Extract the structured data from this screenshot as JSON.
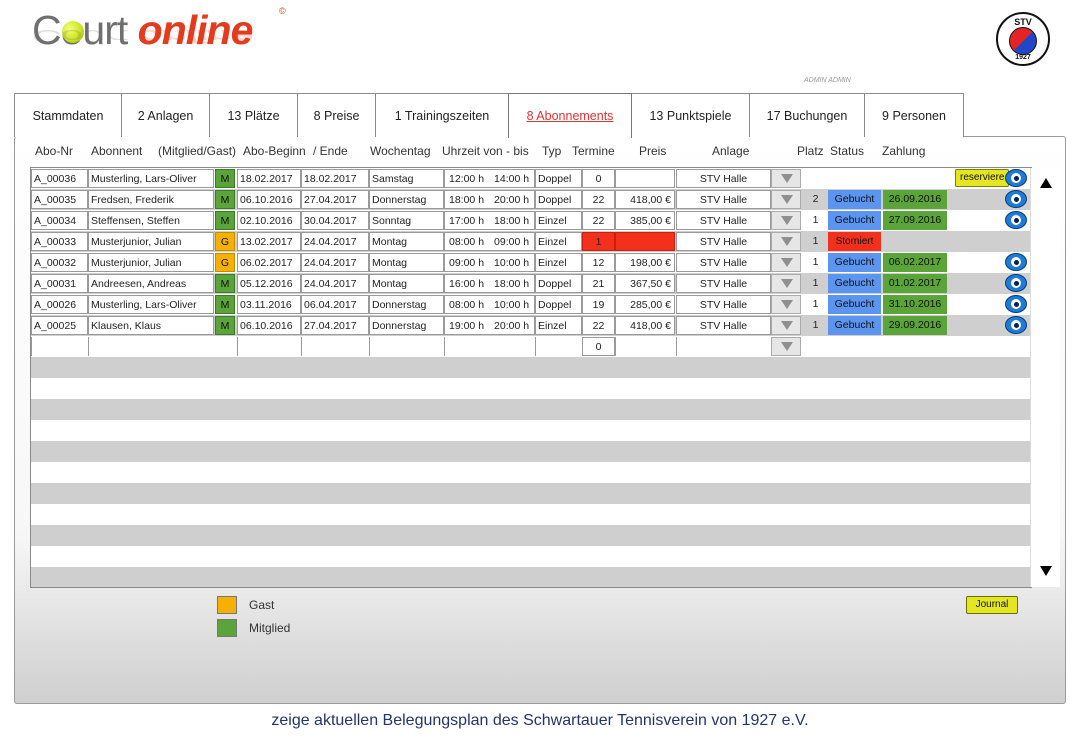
{
  "header": {
    "logo_court": "Court",
    "logo_online": "online",
    "logo_copyright": "©",
    "seal_top": "STV",
    "seal_bottom": "1927",
    "user_label": "ADMIN ADMIN"
  },
  "tabs": [
    {
      "label": "Stammdaten",
      "active": false
    },
    {
      "label": "2 Anlagen",
      "active": false
    },
    {
      "label": "13 Plätze",
      "active": false
    },
    {
      "label": "8 Preise",
      "active": false
    },
    {
      "label": "1 Trainingszeiten",
      "active": false
    },
    {
      "label": "8 Abonnements",
      "active": true
    },
    {
      "label": "13 Punktspiele",
      "active": false
    },
    {
      "label": "17 Buchungen",
      "active": false
    },
    {
      "label": "9 Personen",
      "active": false
    }
  ],
  "columns": {
    "abo_nr": "Abo-Nr",
    "abonnent": "Abonnent",
    "mitglied_gast": "(Mitglied/Gast)",
    "abo_beginn": "Abo-Beginn",
    "ende": "/ Ende",
    "wochentag": "Wochentag",
    "uhrzeit": "Uhrzeit von - bis",
    "typ": "Typ",
    "termine": "Termine",
    "preis": "Preis",
    "anlage": "Anlage",
    "platz": "Platz",
    "status": "Status",
    "zahlung": "Zahlung"
  },
  "rows": [
    {
      "abo_nr": "A_00036",
      "abonnent": "Musterling, Lars-Oliver",
      "mg": "M",
      "beginn": "18.02.2017",
      "ende": "18.02.2017",
      "wochentag": "Samstag",
      "von": "12:00 h",
      "bis": "14:00 h",
      "typ": "Doppel",
      "termine": "0",
      "preis": "",
      "anlage": "STV Halle",
      "platz": "",
      "status": "",
      "zahlung": "",
      "action": "reserviere",
      "eye": true
    },
    {
      "abo_nr": "A_00035",
      "abonnent": "Fredsen, Frederik",
      "mg": "M",
      "beginn": "06.10.2016",
      "ende": "27.04.2017",
      "wochentag": "Donnerstag",
      "von": "18:00 h",
      "bis": "20:00 h",
      "typ": "Doppel",
      "termine": "22",
      "preis": "418,00 €",
      "anlage": "STV Halle",
      "platz": "2",
      "status": "Gebucht",
      "zahlung": "26.09.2016",
      "action": "",
      "eye": true
    },
    {
      "abo_nr": "A_00034",
      "abonnent": "Steffensen, Steffen",
      "mg": "M",
      "beginn": "02.10.2016",
      "ende": "30.04.2017",
      "wochentag": "Sonntag",
      "von": "17:00 h",
      "bis": "18:00 h",
      "typ": "Einzel",
      "termine": "22",
      "preis": "385,00 €",
      "anlage": "STV Halle",
      "platz": "1",
      "status": "Gebucht",
      "zahlung": "27.09.2016",
      "action": "",
      "eye": true
    },
    {
      "abo_nr": "A_00033",
      "abonnent": "Musterjunior, Julian",
      "mg": "G",
      "beginn": "13.02.2017",
      "ende": "24.04.2017",
      "wochentag": "Montag",
      "von": "08:00 h",
      "bis": "09:00 h",
      "typ": "Einzel",
      "termine": "1",
      "preis": "",
      "anlage": "STV Halle",
      "platz": "1",
      "status": "Storniert",
      "zahlung": "",
      "action": "",
      "eye": false
    },
    {
      "abo_nr": "A_00032",
      "abonnent": "Musterjunior, Julian",
      "mg": "G",
      "beginn": "06.02.2017",
      "ende": "24.04.2017",
      "wochentag": "Montag",
      "von": "09:00 h",
      "bis": "10:00 h",
      "typ": "Einzel",
      "termine": "12",
      "preis": "198,00 €",
      "anlage": "STV Halle",
      "platz": "1",
      "status": "Gebucht",
      "zahlung": "06.02.2017",
      "action": "",
      "eye": true
    },
    {
      "abo_nr": "A_00031",
      "abonnent": "Andreesen, Andreas",
      "mg": "M",
      "beginn": "05.12.2016",
      "ende": "24.04.2017",
      "wochentag": "Montag",
      "von": "16:00 h",
      "bis": "18:00 h",
      "typ": "Doppel",
      "termine": "21",
      "preis": "367,50 €",
      "anlage": "STV Halle",
      "platz": "1",
      "status": "Gebucht",
      "zahlung": "01.02.2017",
      "action": "",
      "eye": true
    },
    {
      "abo_nr": "A_00026",
      "abonnent": "Musterling, Lars-Oliver",
      "mg": "M",
      "beginn": "03.11.2016",
      "ende": "06.04.2017",
      "wochentag": "Donnerstag",
      "von": "08:00 h",
      "bis": "10:00 h",
      "typ": "Doppel",
      "termine": "19",
      "preis": "285,00 €",
      "anlage": "STV Halle",
      "platz": "1",
      "status": "Gebucht",
      "zahlung": "31.10.2016",
      "action": "",
      "eye": true
    },
    {
      "abo_nr": "A_00025",
      "abonnent": "Klausen, Klaus",
      "mg": "M",
      "beginn": "06.10.2016",
      "ende": "27.04.2017",
      "wochentag": "Donnerstag",
      "von": "19:00 h",
      "bis": "20:00 h",
      "typ": "Einzel",
      "termine": "22",
      "preis": "418,00 €",
      "anlage": "STV Halle",
      "platz": "1",
      "status": "Gebucht",
      "zahlung": "29.09.2016",
      "action": "",
      "eye": true
    }
  ],
  "new_row": {
    "termine": "0"
  },
  "empty_row_count": 11,
  "legend": [
    {
      "label": "Gast",
      "color": "#f5b000"
    },
    {
      "label": "Mitglied",
      "color": "#5aa43a"
    }
  ],
  "journal_button": "Journal",
  "footer_text": "zeige aktuellen Belegungsplan des Schwartauer Tennisverein von 1927 e.V.",
  "colors": {
    "brand_red": "#e23b1d",
    "status_gebucht": "#5b95f0",
    "status_storniert": "#f2301c",
    "paid_green": "#5aa43a",
    "guest_orange": "#f5b000",
    "button_yellow": "#e4e622"
  }
}
